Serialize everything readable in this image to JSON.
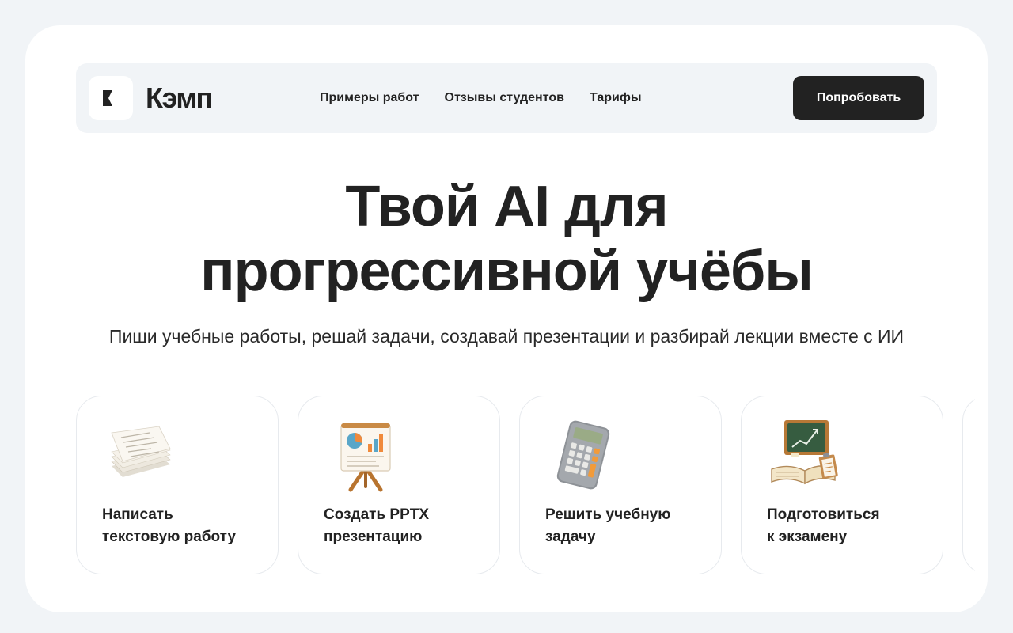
{
  "brand": {
    "name": "Кэмп"
  },
  "nav": {
    "links": [
      "Примеры работ",
      "Отзывы студентов",
      "Тарифы"
    ],
    "cta_label": "Попробовать"
  },
  "hero": {
    "title_lines": [
      "Твой AI для",
      "прогрессивной учёбы"
    ],
    "subtitle": "Пиши учебные работы, решай задачи, создавай презентации и разбирай лекции вместе с ИИ"
  },
  "cards": [
    {
      "icon": "paper-stack-icon",
      "label_lines": [
        "Написать",
        "текстовую работу"
      ]
    },
    {
      "icon": "presentation-easel-icon",
      "label_lines": [
        "Создать PPTX",
        "презентацию"
      ]
    },
    {
      "icon": "calculator-icon",
      "label_lines": [
        "Решить учебную",
        "задачу"
      ]
    },
    {
      "icon": "exam-prep-icon",
      "label_lines": [
        "Подготовиться",
        "к экзамену"
      ]
    }
  ],
  "colors": {
    "page_background": "#f1f4f7",
    "card_background": "#ffffff",
    "text": "#222222",
    "cta_background": "#222222",
    "cta_text": "#ffffff"
  }
}
